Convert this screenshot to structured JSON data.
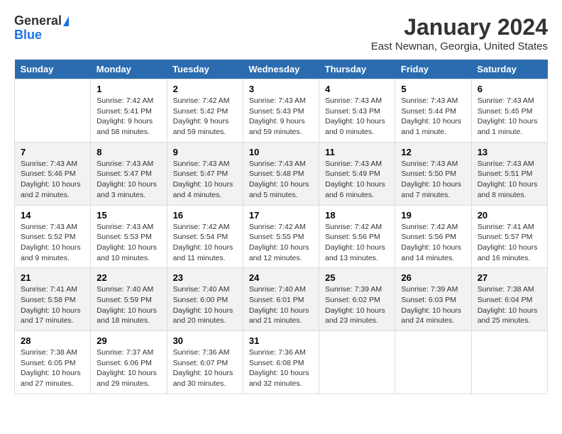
{
  "logo": {
    "general": "General",
    "blue": "Blue"
  },
  "title": "January 2024",
  "subtitle": "East Newnan, Georgia, United States",
  "header_days": [
    "Sunday",
    "Monday",
    "Tuesday",
    "Wednesday",
    "Thursday",
    "Friday",
    "Saturday"
  ],
  "weeks": [
    [
      {
        "day": "",
        "sunrise": "",
        "sunset": "",
        "daylight": ""
      },
      {
        "day": "1",
        "sunrise": "Sunrise: 7:42 AM",
        "sunset": "Sunset: 5:41 PM",
        "daylight": "Daylight: 9 hours and 58 minutes."
      },
      {
        "day": "2",
        "sunrise": "Sunrise: 7:42 AM",
        "sunset": "Sunset: 5:42 PM",
        "daylight": "Daylight: 9 hours and 59 minutes."
      },
      {
        "day": "3",
        "sunrise": "Sunrise: 7:43 AM",
        "sunset": "Sunset: 5:43 PM",
        "daylight": "Daylight: 9 hours and 59 minutes."
      },
      {
        "day": "4",
        "sunrise": "Sunrise: 7:43 AM",
        "sunset": "Sunset: 5:43 PM",
        "daylight": "Daylight: 10 hours and 0 minutes."
      },
      {
        "day": "5",
        "sunrise": "Sunrise: 7:43 AM",
        "sunset": "Sunset: 5:44 PM",
        "daylight": "Daylight: 10 hours and 1 minute."
      },
      {
        "day": "6",
        "sunrise": "Sunrise: 7:43 AM",
        "sunset": "Sunset: 5:45 PM",
        "daylight": "Daylight: 10 hours and 1 minute."
      }
    ],
    [
      {
        "day": "7",
        "sunrise": "Sunrise: 7:43 AM",
        "sunset": "Sunset: 5:46 PM",
        "daylight": "Daylight: 10 hours and 2 minutes."
      },
      {
        "day": "8",
        "sunrise": "Sunrise: 7:43 AM",
        "sunset": "Sunset: 5:47 PM",
        "daylight": "Daylight: 10 hours and 3 minutes."
      },
      {
        "day": "9",
        "sunrise": "Sunrise: 7:43 AM",
        "sunset": "Sunset: 5:47 PM",
        "daylight": "Daylight: 10 hours and 4 minutes."
      },
      {
        "day": "10",
        "sunrise": "Sunrise: 7:43 AM",
        "sunset": "Sunset: 5:48 PM",
        "daylight": "Daylight: 10 hours and 5 minutes."
      },
      {
        "day": "11",
        "sunrise": "Sunrise: 7:43 AM",
        "sunset": "Sunset: 5:49 PM",
        "daylight": "Daylight: 10 hours and 6 minutes."
      },
      {
        "day": "12",
        "sunrise": "Sunrise: 7:43 AM",
        "sunset": "Sunset: 5:50 PM",
        "daylight": "Daylight: 10 hours and 7 minutes."
      },
      {
        "day": "13",
        "sunrise": "Sunrise: 7:43 AM",
        "sunset": "Sunset: 5:51 PM",
        "daylight": "Daylight: 10 hours and 8 minutes."
      }
    ],
    [
      {
        "day": "14",
        "sunrise": "Sunrise: 7:43 AM",
        "sunset": "Sunset: 5:52 PM",
        "daylight": "Daylight: 10 hours and 9 minutes."
      },
      {
        "day": "15",
        "sunrise": "Sunrise: 7:43 AM",
        "sunset": "Sunset: 5:53 PM",
        "daylight": "Daylight: 10 hours and 10 minutes."
      },
      {
        "day": "16",
        "sunrise": "Sunrise: 7:42 AM",
        "sunset": "Sunset: 5:54 PM",
        "daylight": "Daylight: 10 hours and 11 minutes."
      },
      {
        "day": "17",
        "sunrise": "Sunrise: 7:42 AM",
        "sunset": "Sunset: 5:55 PM",
        "daylight": "Daylight: 10 hours and 12 minutes."
      },
      {
        "day": "18",
        "sunrise": "Sunrise: 7:42 AM",
        "sunset": "Sunset: 5:56 PM",
        "daylight": "Daylight: 10 hours and 13 minutes."
      },
      {
        "day": "19",
        "sunrise": "Sunrise: 7:42 AM",
        "sunset": "Sunset: 5:56 PM",
        "daylight": "Daylight: 10 hours and 14 minutes."
      },
      {
        "day": "20",
        "sunrise": "Sunrise: 7:41 AM",
        "sunset": "Sunset: 5:57 PM",
        "daylight": "Daylight: 10 hours and 16 minutes."
      }
    ],
    [
      {
        "day": "21",
        "sunrise": "Sunrise: 7:41 AM",
        "sunset": "Sunset: 5:58 PM",
        "daylight": "Daylight: 10 hours and 17 minutes."
      },
      {
        "day": "22",
        "sunrise": "Sunrise: 7:40 AM",
        "sunset": "Sunset: 5:59 PM",
        "daylight": "Daylight: 10 hours and 18 minutes."
      },
      {
        "day": "23",
        "sunrise": "Sunrise: 7:40 AM",
        "sunset": "Sunset: 6:00 PM",
        "daylight": "Daylight: 10 hours and 20 minutes."
      },
      {
        "day": "24",
        "sunrise": "Sunrise: 7:40 AM",
        "sunset": "Sunset: 6:01 PM",
        "daylight": "Daylight: 10 hours and 21 minutes."
      },
      {
        "day": "25",
        "sunrise": "Sunrise: 7:39 AM",
        "sunset": "Sunset: 6:02 PM",
        "daylight": "Daylight: 10 hours and 23 minutes."
      },
      {
        "day": "26",
        "sunrise": "Sunrise: 7:39 AM",
        "sunset": "Sunset: 6:03 PM",
        "daylight": "Daylight: 10 hours and 24 minutes."
      },
      {
        "day": "27",
        "sunrise": "Sunrise: 7:38 AM",
        "sunset": "Sunset: 6:04 PM",
        "daylight": "Daylight: 10 hours and 25 minutes."
      }
    ],
    [
      {
        "day": "28",
        "sunrise": "Sunrise: 7:38 AM",
        "sunset": "Sunset: 6:05 PM",
        "daylight": "Daylight: 10 hours and 27 minutes."
      },
      {
        "day": "29",
        "sunrise": "Sunrise: 7:37 AM",
        "sunset": "Sunset: 6:06 PM",
        "daylight": "Daylight: 10 hours and 29 minutes."
      },
      {
        "day": "30",
        "sunrise": "Sunrise: 7:36 AM",
        "sunset": "Sunset: 6:07 PM",
        "daylight": "Daylight: 10 hours and 30 minutes."
      },
      {
        "day": "31",
        "sunrise": "Sunrise: 7:36 AM",
        "sunset": "Sunset: 6:08 PM",
        "daylight": "Daylight: 10 hours and 32 minutes."
      },
      {
        "day": "",
        "sunrise": "",
        "sunset": "",
        "daylight": ""
      },
      {
        "day": "",
        "sunrise": "",
        "sunset": "",
        "daylight": ""
      },
      {
        "day": "",
        "sunrise": "",
        "sunset": "",
        "daylight": ""
      }
    ]
  ]
}
